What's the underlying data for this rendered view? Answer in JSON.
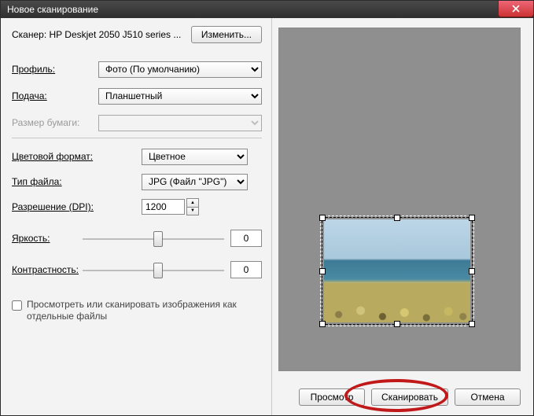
{
  "window": {
    "title": "Новое сканирование"
  },
  "scanner": {
    "label": "Сканер: HP Deskjet 2050 J510 series ...",
    "change_btn": "Изменить..."
  },
  "fields": {
    "profile": {
      "label": "Профиль:",
      "value": "Фото (По умолчанию)"
    },
    "source": {
      "label": "Подача:",
      "value": "Планшетный"
    },
    "paper": {
      "label": "Размер бумаги:",
      "value": ""
    },
    "color": {
      "label": "Цветовой формат:",
      "value": "Цветное"
    },
    "filetype": {
      "label": "Тип файла:",
      "value": "JPG (Файл \"JPG\")"
    },
    "dpi": {
      "label": "Разрешение (DPI):",
      "value": "1200"
    },
    "brightness": {
      "label": "Яркость:",
      "value": "0"
    },
    "contrast": {
      "label": "Контрастность:",
      "value": "0"
    },
    "separate": {
      "label": "Просмотреть или сканировать изображения как отдельные файлы"
    }
  },
  "footer": {
    "preview": "Просмотр",
    "scan": "Сканировать",
    "cancel": "Отмена"
  }
}
